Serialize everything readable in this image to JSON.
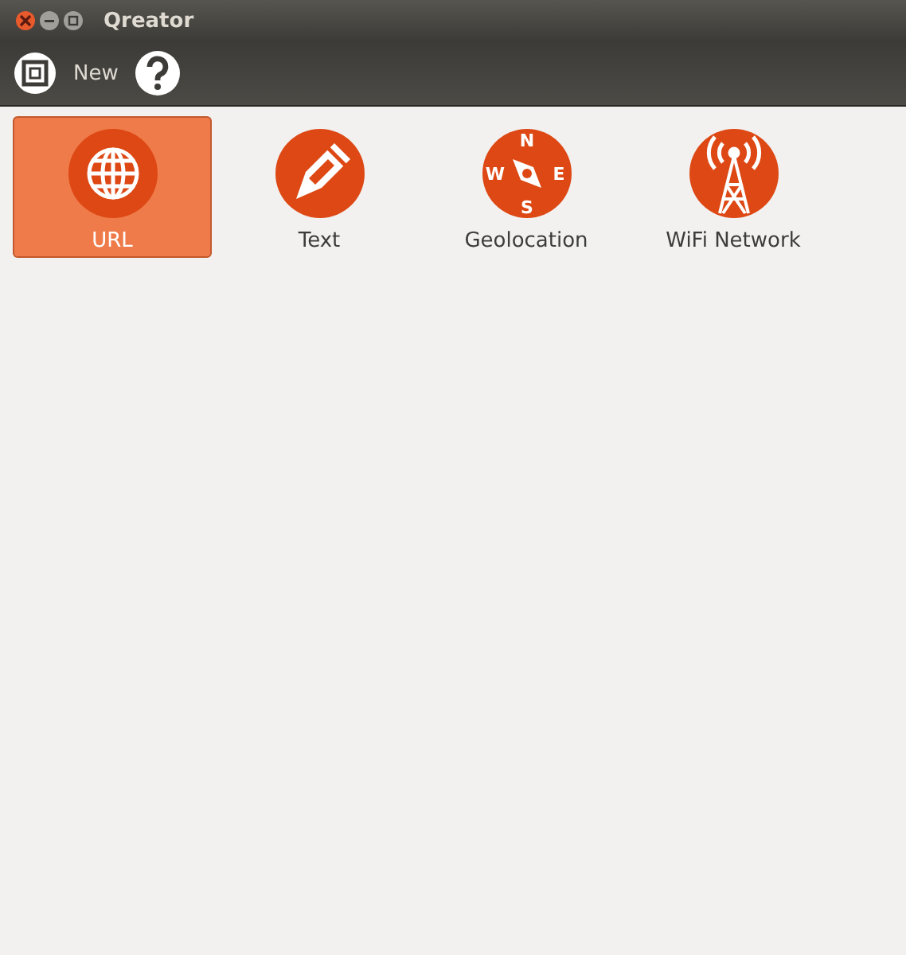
{
  "window": {
    "title": "Qreator"
  },
  "toolbar": [
    {
      "kind": "new",
      "label": "New"
    },
    {
      "kind": "help"
    }
  ],
  "items": [
    {
      "kind": "url",
      "label": "URL",
      "selected": true
    },
    {
      "kind": "text",
      "label": "Text",
      "selected": false
    },
    {
      "kind": "geo",
      "label": "Geolocation",
      "selected": false,
      "compass": [
        "N",
        "W",
        "E",
        "S"
      ]
    },
    {
      "kind": "wifi",
      "label": "WiFi Network",
      "selected": false
    }
  ]
}
